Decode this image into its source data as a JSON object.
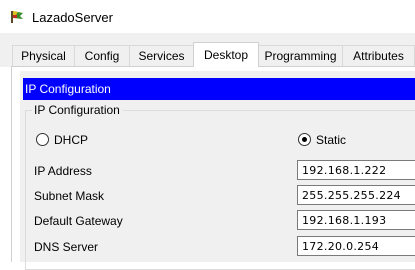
{
  "window": {
    "title": "LazadoServer",
    "icon": "server-flag-icon"
  },
  "tabs": [
    {
      "label": "Physical",
      "active": false
    },
    {
      "label": "Config",
      "active": false
    },
    {
      "label": "Services",
      "active": false
    },
    {
      "label": "Desktop",
      "active": true
    },
    {
      "label": "Programming",
      "active": false
    },
    {
      "label": "Attributes",
      "active": false
    }
  ],
  "ip_config": {
    "header": "IP Configuration",
    "group_title": "IP Configuration",
    "mode_options": [
      {
        "label": "DHCP",
        "selected": false
      },
      {
        "label": "Static",
        "selected": true
      }
    ],
    "fields": {
      "ip_address": {
        "label": "IP Address",
        "value": "192.168.1.222"
      },
      "subnet_mask": {
        "label": "Subnet Mask",
        "value": "255.255.255.224"
      },
      "default_gateway": {
        "label": "Default Gateway",
        "value": "192.168.1.193"
      },
      "dns_server": {
        "label": "DNS Server",
        "value": "172.20.0.254"
      }
    }
  },
  "colors": {
    "header_bar": "#0000ff",
    "header_text": "#ffffff",
    "tab_background": "#f0f0f0",
    "content_background": "#f0f0f0"
  }
}
